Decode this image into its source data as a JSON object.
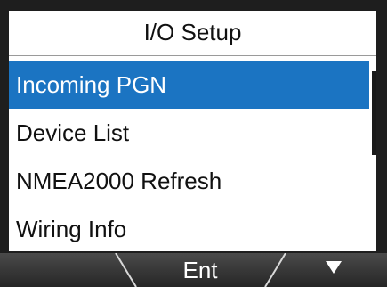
{
  "screen": {
    "title": "I/O Setup",
    "menu_items": [
      {
        "label": "Incoming PGN",
        "selected": true
      },
      {
        "label": "Device List",
        "selected": false
      },
      {
        "label": "NMEA2000 Refresh",
        "selected": false
      },
      {
        "label": "Wiring Info",
        "selected": false
      }
    ]
  },
  "softkeys": {
    "left_label": "",
    "center_label": "Ent",
    "right_icon": "down-triangle-icon"
  },
  "colors": {
    "selection": "#1b74c2",
    "bezel": "#1e1e1e",
    "softkey_bar": "#3a3a3a"
  }
}
